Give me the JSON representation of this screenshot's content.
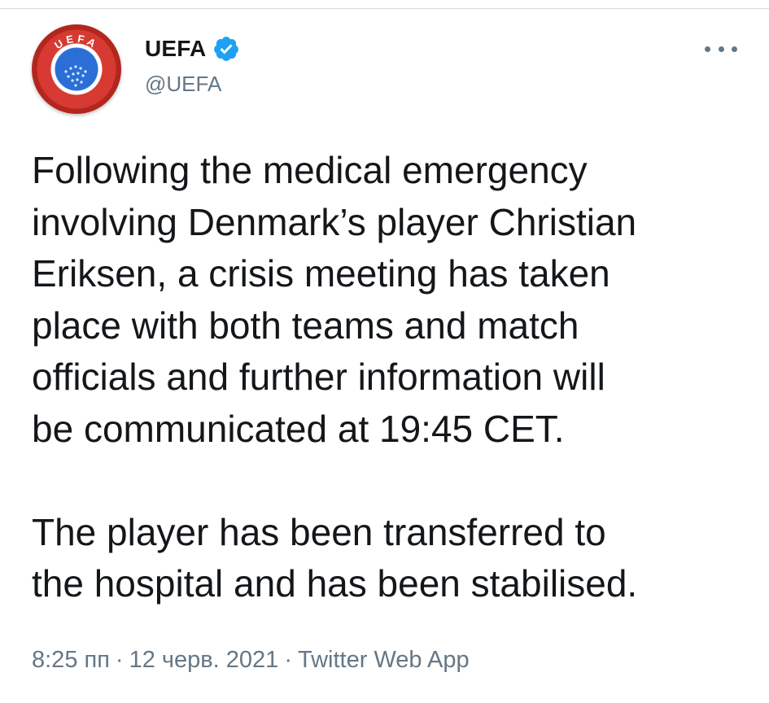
{
  "tweet": {
    "author": {
      "display_name": "UEFA",
      "handle": "@UEFA",
      "verified": true,
      "avatar_text": "UEFA"
    },
    "text_paragraphs": [
      "Following the medical emergency\ninvolving Denmark’s player Christian\nEriksen, a crisis meeting has taken\nplace with both teams and match\nofficials and further information will\nbe communicated at 19:45 CET.",
      "The player has been transferred to\nthe hospital and has been stabilised."
    ],
    "meta": {
      "time": "8:25 пп",
      "separator": "·",
      "date": "12 черв. 2021",
      "source": "Twitter Web App"
    }
  },
  "icons": {
    "more": "more-horizontal-icon",
    "verified": "verified-badge-icon"
  },
  "colors": {
    "text_primary": "#14171a",
    "text_secondary": "#657786",
    "verified_blue": "#1da1f2",
    "uefa_red": "#d63a32",
    "uefa_blue": "#2b6fd6"
  }
}
